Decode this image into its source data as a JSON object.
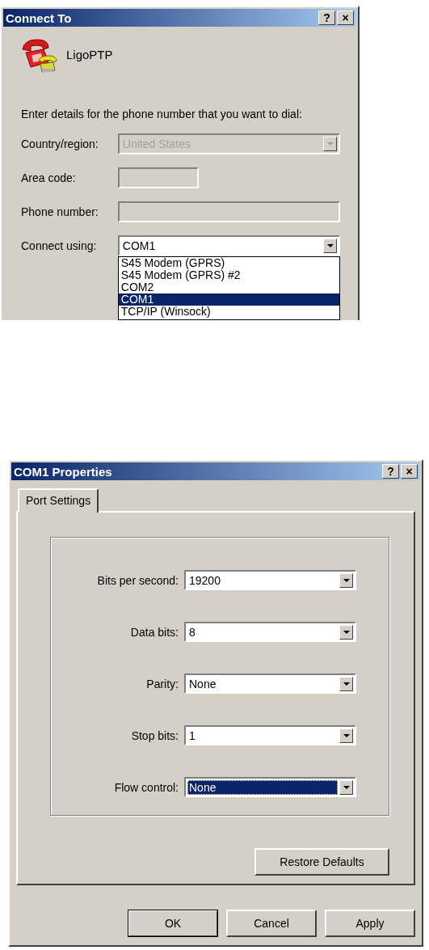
{
  "connect_dialog": {
    "title": "Connect To",
    "title_buttons": [
      "?",
      "×"
    ],
    "connection_name": "LigoPTP",
    "instruction": "Enter details for the phone number that you want to dial:",
    "fields": [
      {
        "kind": "combo",
        "label": "Country/region:",
        "value": "United States",
        "disabled": true
      },
      {
        "kind": "short_input",
        "label": "Area code:",
        "disabled": true
      },
      {
        "kind": "input",
        "label": "Phone number:",
        "disabled": true
      },
      {
        "kind": "combo",
        "label": "Connect using:",
        "value": "COM1",
        "disabled": false,
        "expanded": true,
        "options": [
          {
            "label": "S45 Modem (GPRS)",
            "selected": false
          },
          {
            "label": "S45 Modem (GPRS) #2",
            "selected": false
          },
          {
            "label": "COM2",
            "selected": false
          },
          {
            "label": "COM1",
            "selected": true
          },
          {
            "label": "TCP/IP (Winsock)",
            "selected": false
          }
        ]
      }
    ]
  },
  "properties_dialog": {
    "title": "COM1 Properties",
    "title_buttons": [
      "?",
      "×"
    ],
    "tabs": [
      {
        "label": "Port Settings",
        "selected": true
      }
    ],
    "fields": [
      {
        "label": "Bits per second:",
        "value": "19200",
        "selected": false
      },
      {
        "label": "Data bits:",
        "value": "8",
        "selected": false
      },
      {
        "label": "Parity:",
        "value": "None",
        "selected": false
      },
      {
        "label": "Stop bits:",
        "value": "1",
        "selected": false
      },
      {
        "label": "Flow control:",
        "value": "None",
        "selected": true
      }
    ],
    "restore_button": "Restore Defaults",
    "buttons": [
      {
        "label": "OK",
        "default": true
      },
      {
        "label": "Cancel",
        "default": false
      },
      {
        "label": "Apply",
        "default": false
      }
    ]
  }
}
